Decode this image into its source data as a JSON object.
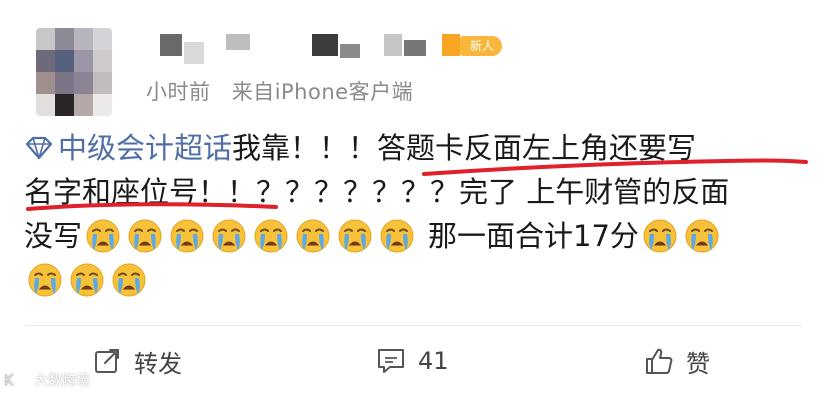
{
  "header": {
    "badge": "新人",
    "time_text": "小时前",
    "source_prefix": "来自",
    "source_app": "iPhone客户端"
  },
  "post": {
    "topic": "中级会计超话",
    "line1_rest": "我靠！！！答题卡反面左上角还要写",
    "line2": "名字和座位号！！？？？？？？？完了 上午财管的反面",
    "line3_text": "没写",
    "line3_tail": "那一面合计17分",
    "emoji_name": "crying-face"
  },
  "footer": {
    "repost_label": "转发",
    "comment_count": "41",
    "like_label": "赞"
  },
  "watermark": {
    "text": "大数跨境"
  },
  "colors": {
    "badge": "#f8b63a",
    "topic_link": "#4f6fa6",
    "underline": "#e0202a",
    "meta_text": "#8a8a8a"
  }
}
